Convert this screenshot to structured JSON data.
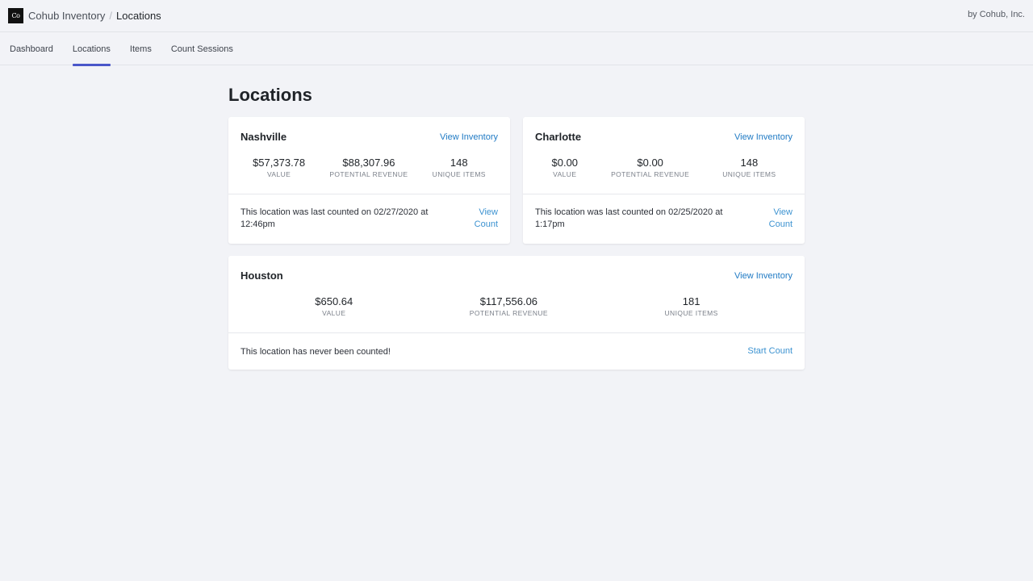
{
  "header": {
    "logo_text": "Co",
    "app_name": "Cohub Inventory",
    "separator": "/",
    "current_page": "Locations",
    "byline": "by Cohub, Inc."
  },
  "nav": {
    "tabs": [
      {
        "label": "Dashboard",
        "active": false
      },
      {
        "label": "Locations",
        "active": true
      },
      {
        "label": "Items",
        "active": false
      },
      {
        "label": "Count Sessions",
        "active": false
      }
    ]
  },
  "main": {
    "title": "Locations",
    "view_inventory_label": "View Inventory",
    "locations": [
      {
        "name": "Nashville",
        "value": "$57,373.78",
        "value_label": "VALUE",
        "revenue": "$88,307.96",
        "revenue_label": "POTENTIAL REVENUE",
        "items": "148",
        "items_label": "UNIQUE ITEMS",
        "count_message": "This location was last counted on 02/27/2020 at 12:46pm",
        "action_label": "View Count"
      },
      {
        "name": "Charlotte",
        "value": "$0.00",
        "value_label": "VALUE",
        "revenue": "$0.00",
        "revenue_label": "POTENTIAL REVENUE",
        "items": "148",
        "items_label": "UNIQUE ITEMS",
        "count_message": "This location was last counted on 02/25/2020 at 1:17pm",
        "action_label": "View Count"
      },
      {
        "name": "Houston",
        "value": "$650.64",
        "value_label": "VALUE",
        "revenue": "$117,556.06",
        "revenue_label": "POTENTIAL REVENUE",
        "items": "181",
        "items_label": "UNIQUE ITEMS",
        "count_message": "This location has never been counted!",
        "action_label": "Start Count"
      }
    ]
  },
  "colors": {
    "accent": "#4a57c9",
    "link": "#1f7ac4",
    "background": "#f2f3f7"
  }
}
